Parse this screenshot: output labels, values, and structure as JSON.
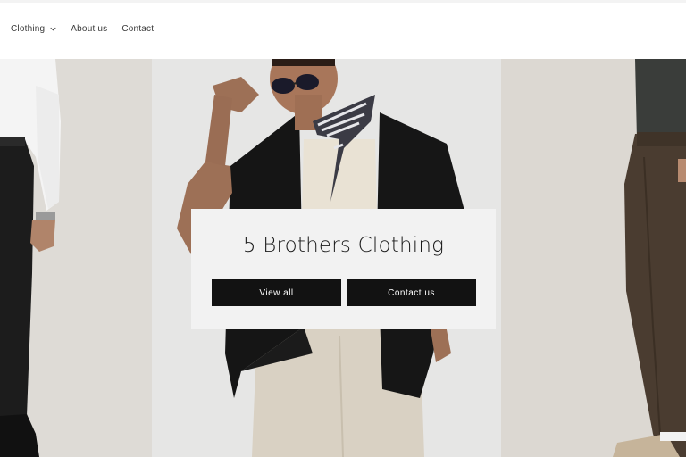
{
  "nav": {
    "items": [
      {
        "label": "Clothing",
        "has_dropdown": true
      },
      {
        "label": "About us",
        "has_dropdown": false
      },
      {
        "label": "Contact",
        "has_dropdown": false
      }
    ]
  },
  "hero": {
    "title": "5 Brothers Clothing",
    "buttons": {
      "view_all": "View all",
      "contact_us": "Contact us"
    },
    "images": [
      "model-left-white-shirt-black-trousers",
      "model-center-black-shirt-sunglasses",
      "model-right-brown-trousers"
    ]
  },
  "colors": {
    "button_bg": "#121212",
    "button_text": "#ffffff",
    "card_bg": "#f2f2f2",
    "nav_text": "#3a3a3a"
  }
}
